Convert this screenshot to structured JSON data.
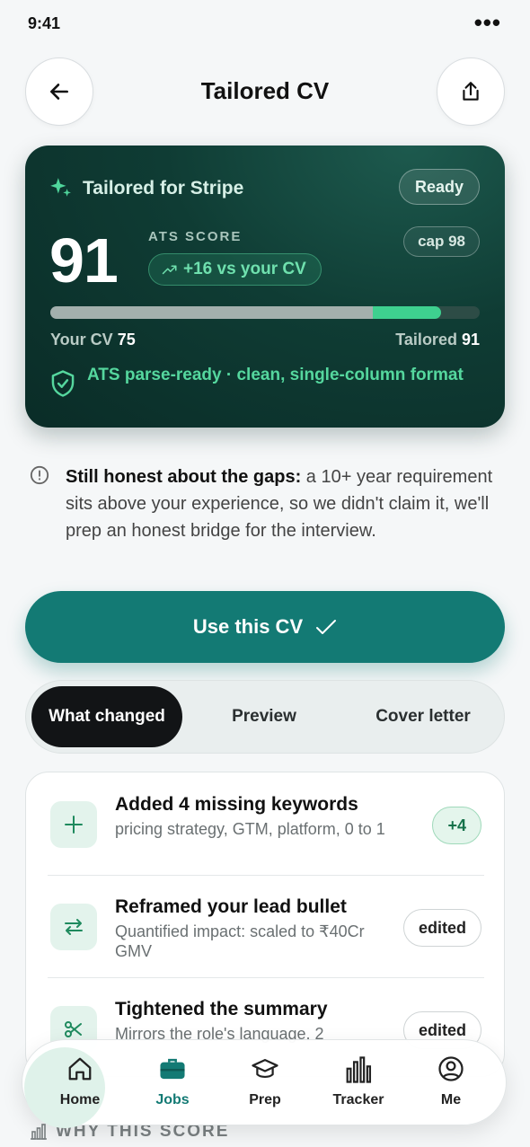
{
  "status_bar": {
    "time": "9:41",
    "more": "•••"
  },
  "header": {
    "title": "Tailored CV",
    "back_icon": "arrow-left-icon",
    "share_icon": "share-icon"
  },
  "score_card": {
    "title": "Tailored for Stripe",
    "status_badge": "Ready",
    "cap_badge": "cap 98",
    "score": "91",
    "ats_label": "ATS SCORE",
    "delta": "+16 vs your CV",
    "your_cv_label": "Your CV",
    "your_cv_score": "75",
    "tailored_label": "Tailored",
    "tailored_score": "91",
    "progress": {
      "your_cv_fraction": 0.75,
      "tailored_fraction": 0.91
    },
    "parse_text": "ATS parse-ready · clean, single-column format",
    "colors": {
      "accent": "#3ed08f",
      "card_bg": "#0f3c34"
    }
  },
  "honesty_note": {
    "lead": "Still honest about the gaps:",
    "body": " a 10+ year requirement sits above your experience, so we didn't claim it, we'll prep an honest bridge for the interview."
  },
  "primary_action": {
    "label": "Use this CV",
    "color": "#137a74"
  },
  "tabs": [
    {
      "label": "What changed",
      "active": true
    },
    {
      "label": "Preview",
      "active": false
    },
    {
      "label": "Cover letter",
      "active": false
    }
  ],
  "changes": [
    {
      "title": "Added 4 missing keywords",
      "subtitle": "pricing strategy, GTM, platform, 0 to 1",
      "badge": "+4",
      "icon": "plus-icon"
    },
    {
      "title": "Reframed your lead bullet",
      "subtitle": "Quantified impact: scaled to ₹40Cr GMV",
      "badge": "edited",
      "icon": "swap-arrows-icon"
    },
    {
      "title": "Tightened the summary",
      "subtitle": "Mirrors the role's language, 2",
      "badge": "edited",
      "icon": "scissors-icon"
    }
  ],
  "bottom_nav": [
    {
      "label": "Home",
      "icon": "home-icon"
    },
    {
      "label": "Jobs",
      "icon": "briefcase-icon",
      "active": true
    },
    {
      "label": "Prep",
      "icon": "graduation-cap-icon"
    },
    {
      "label": "Tracker",
      "icon": "bar-chart-icon"
    },
    {
      "label": "Me",
      "icon": "user-circle-icon"
    }
  ],
  "why_score": {
    "label": "WHY THIS SCORE",
    "icon": "chart-icon"
  }
}
